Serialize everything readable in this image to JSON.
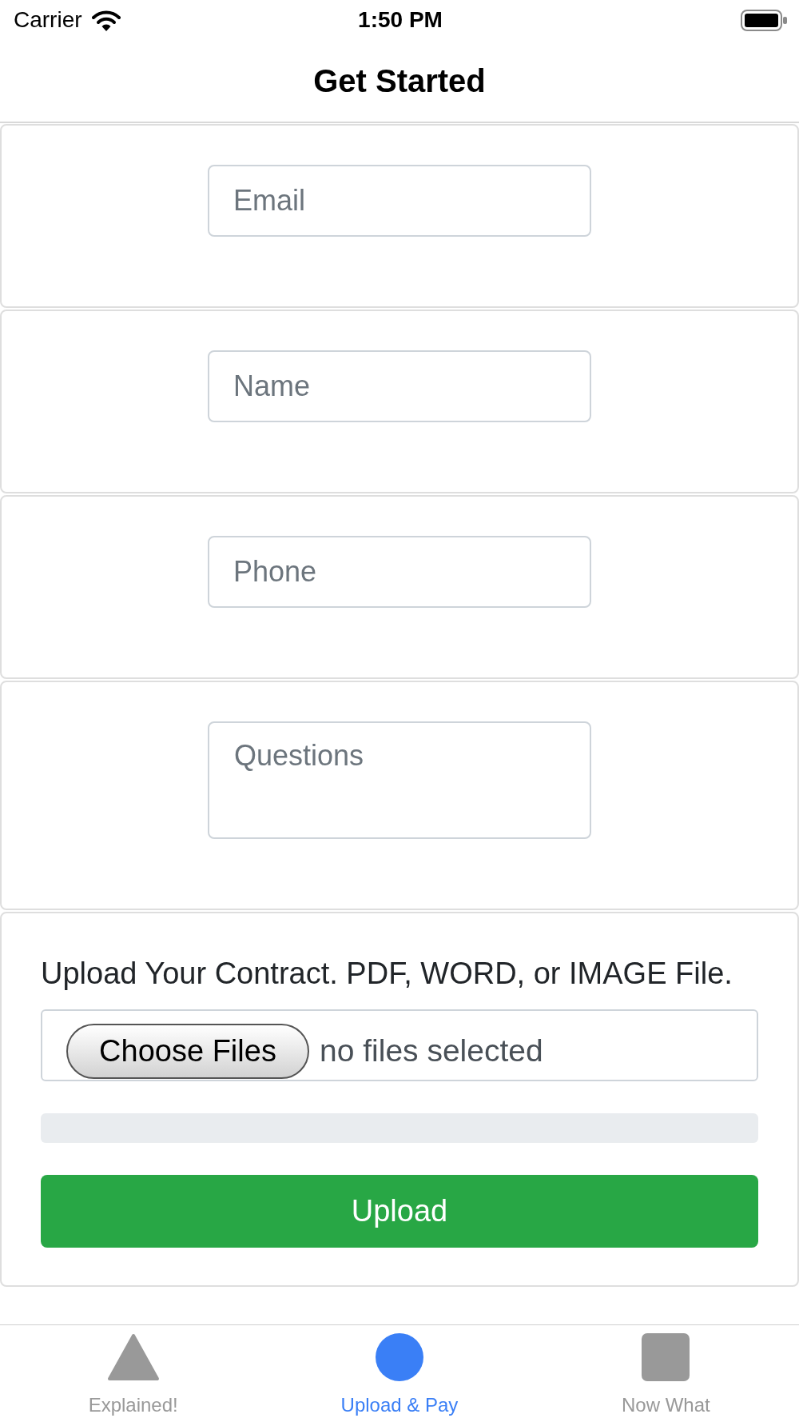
{
  "status_bar": {
    "carrier": "Carrier",
    "time": "1:50 PM"
  },
  "navigation_bar": {
    "title": "Get Started"
  },
  "form_cards": [
    {
      "kind": "input",
      "placeholder": "Email"
    },
    {
      "kind": "input",
      "placeholder": "Name"
    },
    {
      "kind": "input",
      "placeholder": "Phone"
    },
    {
      "kind": "textarea",
      "placeholder": "Questions"
    }
  ],
  "upload_card": {
    "label": "Upload Your Contract. PDF, WORD, or IMAGE File.",
    "choose_button": "Choose Files",
    "file_status": "no files selected",
    "progress": {
      "level": 0
    },
    "submit_button": "Upload"
  },
  "tab_bar": [
    {
      "label": "Explained!",
      "selected": false
    },
    {
      "label": "Upload & Pay",
      "selected": true
    },
    {
      "label": "Now What",
      "selected": false
    }
  ]
}
